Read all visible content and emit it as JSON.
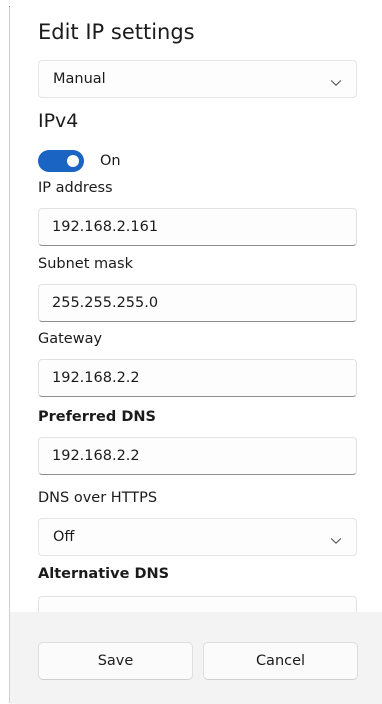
{
  "dialog": {
    "title": "Edit IP settings",
    "mode_select": {
      "value": "Manual",
      "icon": "chevron-down-icon"
    }
  },
  "ipv4": {
    "heading": "IPv4",
    "toggle": {
      "state_label": "On",
      "enabled": true,
      "accent_color": "#1a64c3"
    },
    "ip_address": {
      "label": "IP address",
      "value": "192.168.2.161"
    },
    "subnet_mask": {
      "label": "Subnet mask",
      "value": "255.255.255.0"
    },
    "gateway": {
      "label": "Gateway",
      "value": "192.168.2.2"
    },
    "preferred_dns": {
      "label": "Preferred DNS",
      "value": "192.168.2.2"
    },
    "dns_over_https": {
      "label": "DNS over HTTPS",
      "value": "Off",
      "icon": "chevron-down-icon"
    },
    "alternative_dns": {
      "label": "Alternative DNS",
      "value": ""
    }
  },
  "footer": {
    "save_label": "Save",
    "cancel_label": "Cancel"
  }
}
